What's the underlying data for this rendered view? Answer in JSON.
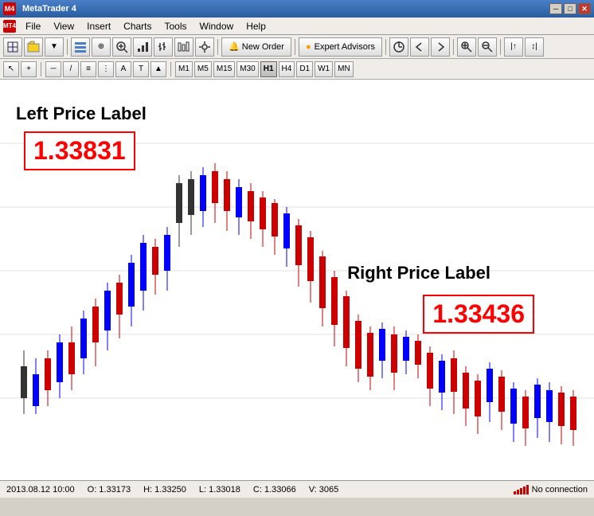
{
  "window": {
    "title": "MetaTrader 4"
  },
  "menu": {
    "items": [
      "File",
      "View",
      "Insert",
      "Charts",
      "Tools",
      "Window",
      "Help"
    ]
  },
  "toolbar": {
    "new_order_label": "New Order",
    "expert_advisors_label": "Expert Advisors"
  },
  "timeframes": {
    "items": [
      "M1",
      "M5",
      "M15",
      "M30",
      "H1",
      "H4",
      "D1",
      "W1",
      "MN"
    ],
    "active": "H1"
  },
  "chart": {
    "left_label": "Left Price Label",
    "left_price": "1.33831",
    "right_label": "Right Price Label",
    "right_price": "1.33436"
  },
  "status_bar": {
    "datetime": "2013.08.12 10:00",
    "open": "O: 1.33173",
    "high": "H: 1.33250",
    "low": "L: 1.33018",
    "close": "C: 1.33066",
    "volume": "V: 3065",
    "connection": "No connection"
  },
  "icons": {
    "minimize": "─",
    "maximize": "□",
    "close": "✕",
    "arrow": "▶",
    "cursor": "↖",
    "crosshair": "+",
    "line": "─",
    "diagonal": "/",
    "text": "A",
    "period": "T",
    "expert_dot": "●"
  }
}
